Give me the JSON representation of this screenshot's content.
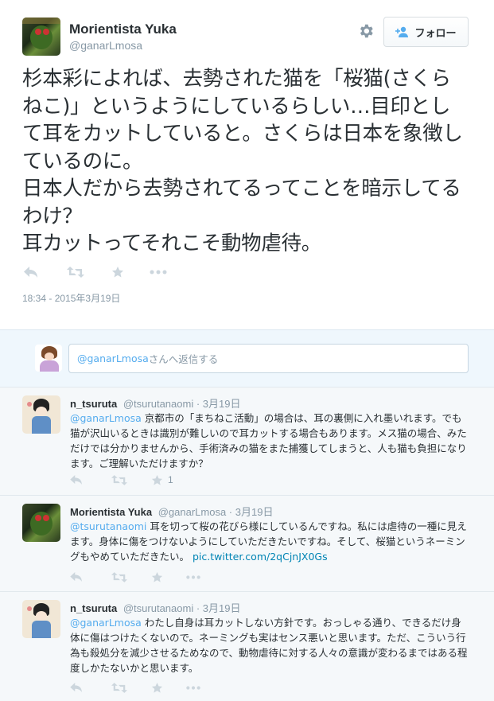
{
  "tweet": {
    "name": "Morientista Yuka",
    "handle": "@ganarLmosa",
    "follow_label": "フォロー",
    "text": "杉本彩によれば、去勢された猫を「桜猫(さくらねこ)」というようにしているらしい…目印として耳をカットしていると。さくらは日本を象徴しているのに。\n日本人だから去勢されてるってことを暗示してるわけ？\n耳カットってそれこそ動物虐待。",
    "timestamp": "18:34 - 2015年3月19日",
    "icons": [
      "gear-icon",
      "user-plus-icon",
      "reply-icon",
      "retweet-icon",
      "favorite-icon",
      "more-icon"
    ]
  },
  "reply_box": {
    "mention": "@ganarLmosa",
    "placeholder_suffix": "さんへ返信する"
  },
  "replies": [
    {
      "name": "n_tsuruta",
      "handle": "@tsurutanaomi",
      "date": "3月19日",
      "mention": "@ganarLmosa",
      "text": " 京都市の「まちねこ活動」の場合は、耳の裏側に入れ墨いれます。でも猫が沢山いるときは識別が難しいので耳カットする場合もあります。メス猫の場合、みただけでは分かりませんから、手術済みの猫をまた捕獲してしまうと、人も猫も負担になります。ご理解いただけますか？",
      "link": "",
      "fav_count": "1"
    },
    {
      "name": "Morientista Yuka",
      "handle": "@ganarLmosa",
      "date": "3月19日",
      "mention": "@tsurutanaomi",
      "text": " 耳を切って桜の花びら様にしているんですね。私には虐待の一種に見えます。身体に傷をつけないようにしていただきたいですね。そして、桜猫というネーミングもやめていただきたい。 ",
      "link": "pic.twitter.com/2qCjnJX0Gs",
      "fav_count": ""
    },
    {
      "name": "n_tsuruta",
      "handle": "@tsurutanaomi",
      "date": "3月19日",
      "mention": "@ganarLmosa",
      "text": " わたし自身は耳カットしない方針です。おっしゃる通り、できるだけ身体に傷はつけたくないので。ネーミングも実はセンス悪いと思います。ただ、こういう行為も殺処分を減少させるためなので、動物虐待に対する人々の意識が変わるまではある程度しかたないかと思います。",
      "link": "",
      "fav_count": ""
    }
  ],
  "colors": {
    "accent": "#55acee",
    "link": "#0084b4",
    "muted": "#8899a6",
    "icon": "#ccd6dd",
    "reply_bg": "#f5f8fa",
    "reply_area_bg": "#eff7fd"
  }
}
